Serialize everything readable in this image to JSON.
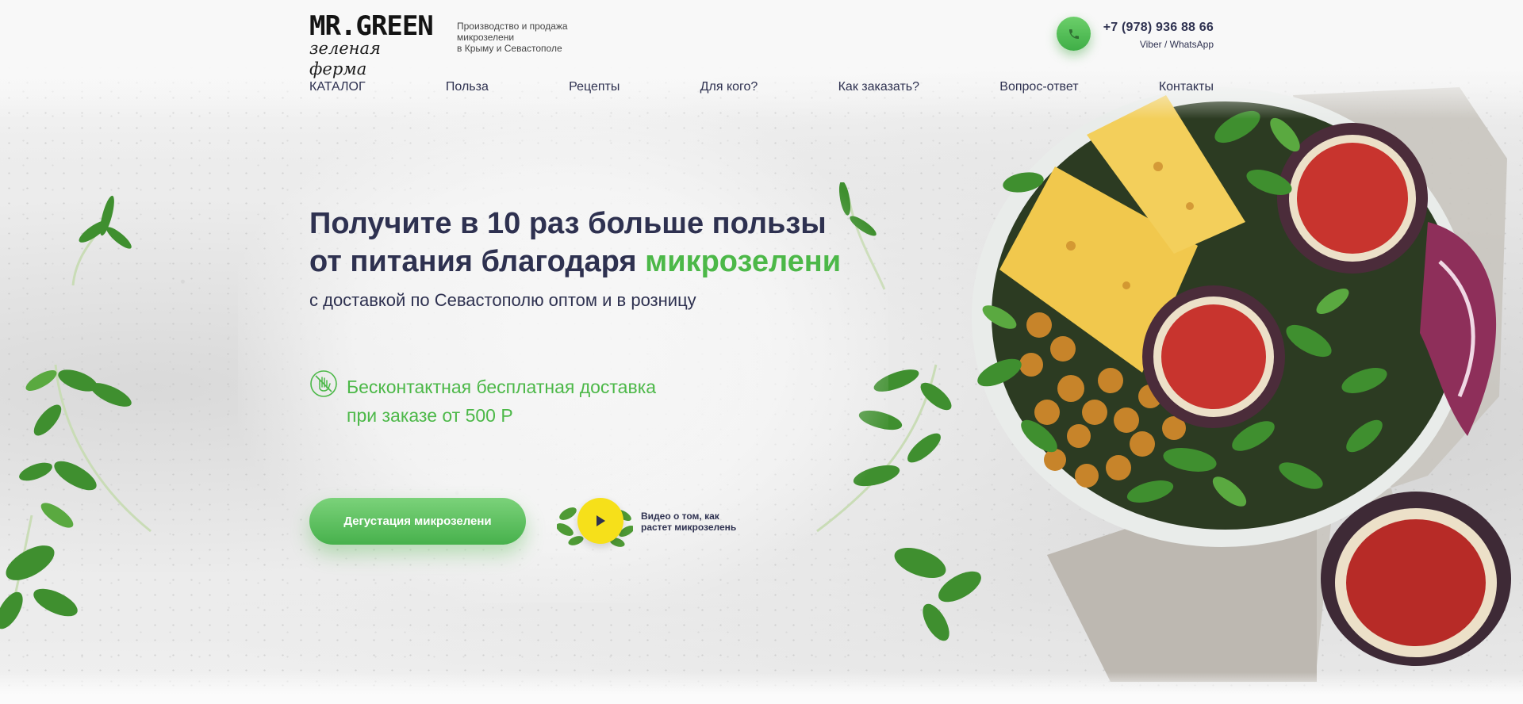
{
  "brand": {
    "logo_top": "MR.GREEN",
    "logo_bottom": "зеленая ферма",
    "tagline": [
      "Производство и продажа",
      "микрозелени",
      "в Крыму и Севастополе"
    ]
  },
  "contact": {
    "phone": "+7 (978) 936 88 66",
    "note": "Viber / WhatsApp",
    "icon": "phone-icon"
  },
  "nav": [
    {
      "label": "КАТАЛОГ"
    },
    {
      "label": "Польза"
    },
    {
      "label": "Рецепты"
    },
    {
      "label": "Для кого?"
    },
    {
      "label": "Как заказать?"
    },
    {
      "label": "Вопрос-ответ"
    },
    {
      "label": "Контакты"
    }
  ],
  "hero": {
    "title_line1": "Получите в 10 раз больше пользы",
    "title_line2_prefix": "от питания благодаря ",
    "title_line2_accent": "микрозелени",
    "subtitle": "с доставкой по Севастополю оптом и в розницу",
    "delivery_line1": "Бесконтактная бесплатная доставка",
    "delivery_line2": "при заказе от 500 Р",
    "delivery_icon": "hand-no-touch-icon",
    "cta_label": "Дегустация микрозелени",
    "video_label_line1": "Видео о том, как",
    "video_label_line2": "растет микрозелень",
    "video_icon": "play-icon"
  },
  "colors": {
    "accent_green": "#4cb848",
    "text_dark": "#2e3150",
    "play_yellow": "#f6e01a"
  }
}
